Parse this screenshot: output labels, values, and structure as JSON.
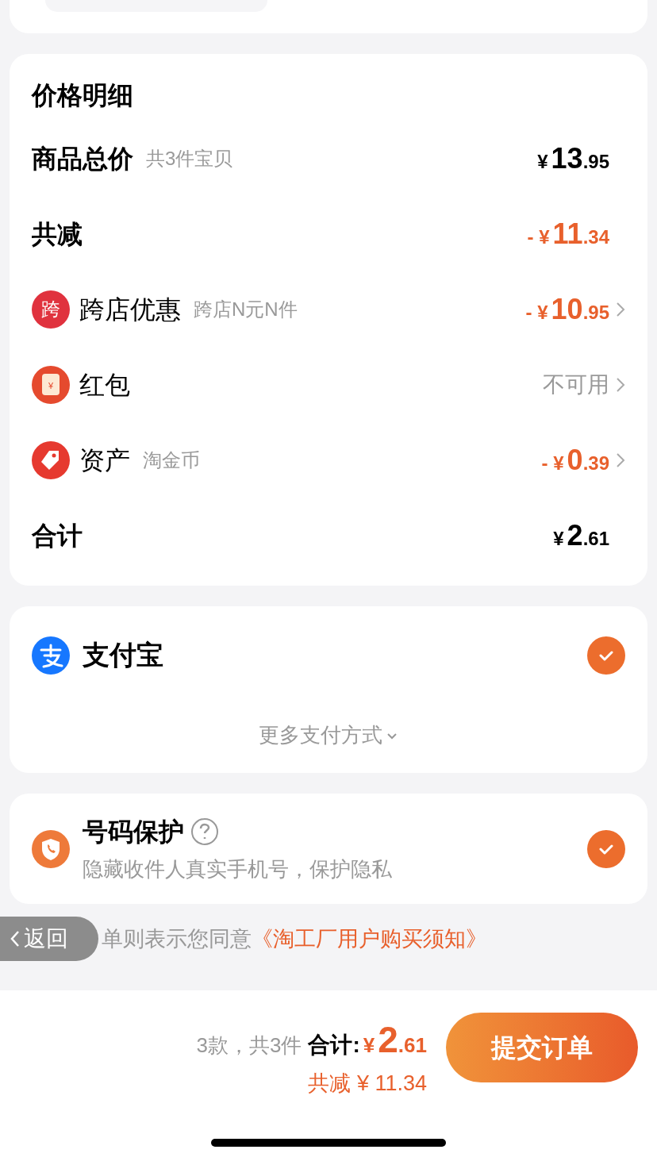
{
  "price_details": {
    "title": "价格明细",
    "rows": [
      {
        "kind": "total",
        "label": "商品总价",
        "note": "共3件宝贝",
        "prefix": "¥",
        "integer": "13",
        "decimal": ".95",
        "accent": false,
        "chevron": false
      },
      {
        "kind": "total",
        "label": "共减",
        "prefix": "- ¥",
        "integer": "11",
        "decimal": ".34",
        "accent": true,
        "chevron": false
      },
      {
        "kind": "promotion",
        "label": "跨店优惠",
        "note": "跨店N元N件",
        "prefix": "- ¥",
        "integer": "10",
        "decimal": ".95",
        "accent": true,
        "chevron": true
      },
      {
        "kind": "packet",
        "label": "红包",
        "status": "不可用",
        "chevron": true
      },
      {
        "kind": "asset",
        "label": "资产",
        "note": "淘金币",
        "prefix": "- ¥",
        "integer": "0",
        "decimal": ".39",
        "accent": true,
        "chevron": true
      },
      {
        "kind": "total",
        "label": "合计",
        "prefix": "¥",
        "integer": "2",
        "decimal": ".61",
        "accent": false,
        "chevron": false
      }
    ],
    "badge_text": "跨",
    "packet_text": "¥"
  },
  "payment": {
    "method": "支付宝",
    "checked": true,
    "more": "更多支付方式"
  },
  "number_protection": {
    "title": "号码保护",
    "description": "隐藏收件人真实手机号，保护隐私",
    "checked": true
  },
  "agreement": {
    "back": "返回",
    "text": "单则表示您同意",
    "link": "《淘工厂用户购买须知》"
  },
  "footer": {
    "count": "3款，共3件",
    "total_label": "合计:",
    "total_prefix": "¥",
    "total_integer": "2",
    "total_decimal": ".61",
    "saved": "共减 ¥ 11.34",
    "submit": "提交订单"
  }
}
